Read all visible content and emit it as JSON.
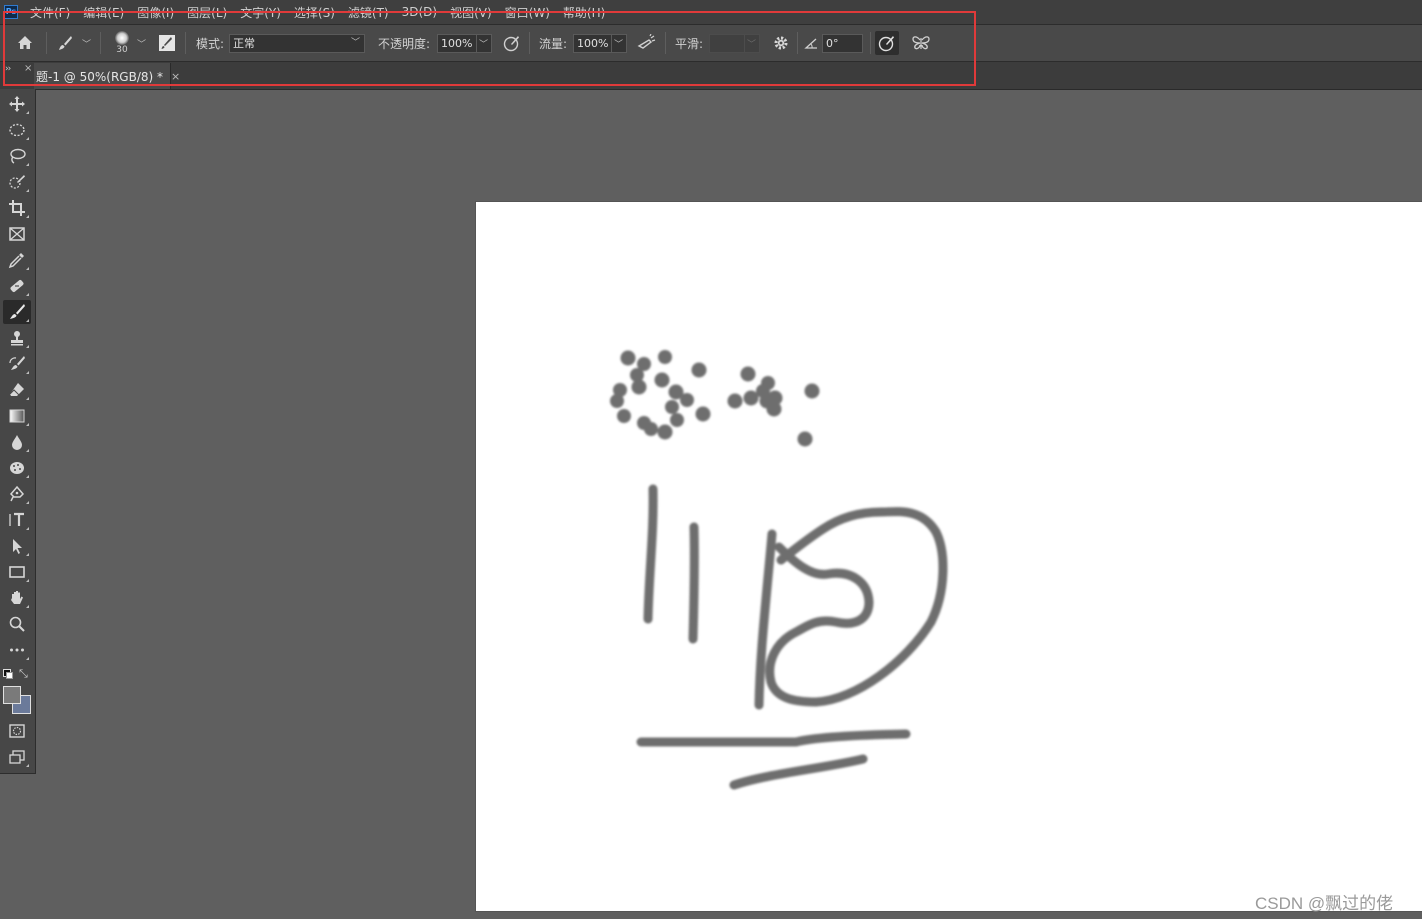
{
  "app": {
    "logo_text": "Ps",
    "menu": [
      "文件(F)",
      "编辑(E)",
      "图像(I)",
      "图层(L)",
      "文字(Y)",
      "选择(S)",
      "滤镜(T)",
      "3D(D)",
      "视图(V)",
      "窗口(W)",
      "帮助(H)"
    ]
  },
  "options_bar": {
    "brush_size": "30",
    "mode_label": "模式:",
    "mode_value": "正常",
    "opacity_label": "不透明度:",
    "opacity_value": "100%",
    "flow_label": "流量:",
    "flow_value": "100%",
    "smoothing_label": "平滑:",
    "smoothing_value": "",
    "angle_value": "0°"
  },
  "document": {
    "tab_title": "题-1 @ 50%(RGB/8) *",
    "close_symbol": "×"
  },
  "colors": {
    "highlight": "#e03a3a",
    "foreground": "#7a7a7a",
    "background": "#6b7a9a",
    "stroke": "#6e6e6e"
  },
  "watermark": "CSDN @飘过的佬"
}
